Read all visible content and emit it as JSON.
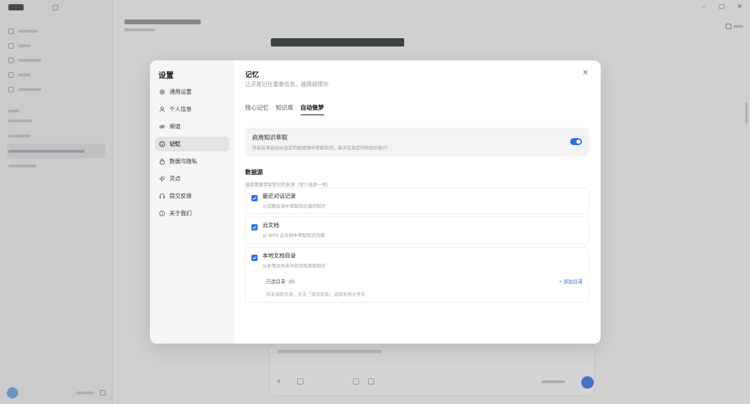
{
  "background": {
    "window_controls": [
      "–",
      "▢",
      "✕"
    ]
  },
  "settings": {
    "title": "设置",
    "nav": [
      {
        "label": "通用设置",
        "icon": "gear-icon"
      },
      {
        "label": "个人信息",
        "icon": "user-icon"
      },
      {
        "label": "频道",
        "icon": "link-icon"
      },
      {
        "label": "记忆",
        "icon": "info-icon",
        "active": true
      },
      {
        "label": "数据与隐私",
        "icon": "lock-icon"
      },
      {
        "label": "灵点",
        "icon": "sparkle-icon"
      },
      {
        "label": "提交反馈",
        "icon": "headset-icon"
      },
      {
        "label": "关于我们",
        "icon": "about-icon"
      }
    ],
    "page": {
      "title": "记忆",
      "subtitle": "让灵犀记住重要信息，越用越懂你",
      "close": "✕",
      "tabs": [
        {
          "label": "核心记忆"
        },
        {
          "label": "知识库"
        },
        {
          "label": "自动做梦",
          "active": true
        }
      ],
      "extraction": {
        "title": "启用知识萃取",
        "description": "开启后将自动从选定的数据源中萃取知识，每天在指定时间段内执行",
        "enabled": true
      },
      "datasource": {
        "title": "数据源",
        "description": "选择需要萃取知识的来源（至少选择一项）",
        "items": [
          {
            "title": "最近对话记录",
            "description": "从近期会话中萃取有价值的知识",
            "checked": true
          },
          {
            "title": "云文档",
            "description": "从 WPS 云文档中萃取知识内容",
            "checked": true
          },
          {
            "title": "本地文档目录",
            "description": "从本地文件夹中的文档萃取知识",
            "checked": true,
            "dir_label": "已选目录（0）",
            "add_label": "+ 添加目录",
            "empty_text": "尚未选择目录，点击「添加目录」选择本地文件夹"
          }
        ]
      }
    }
  }
}
